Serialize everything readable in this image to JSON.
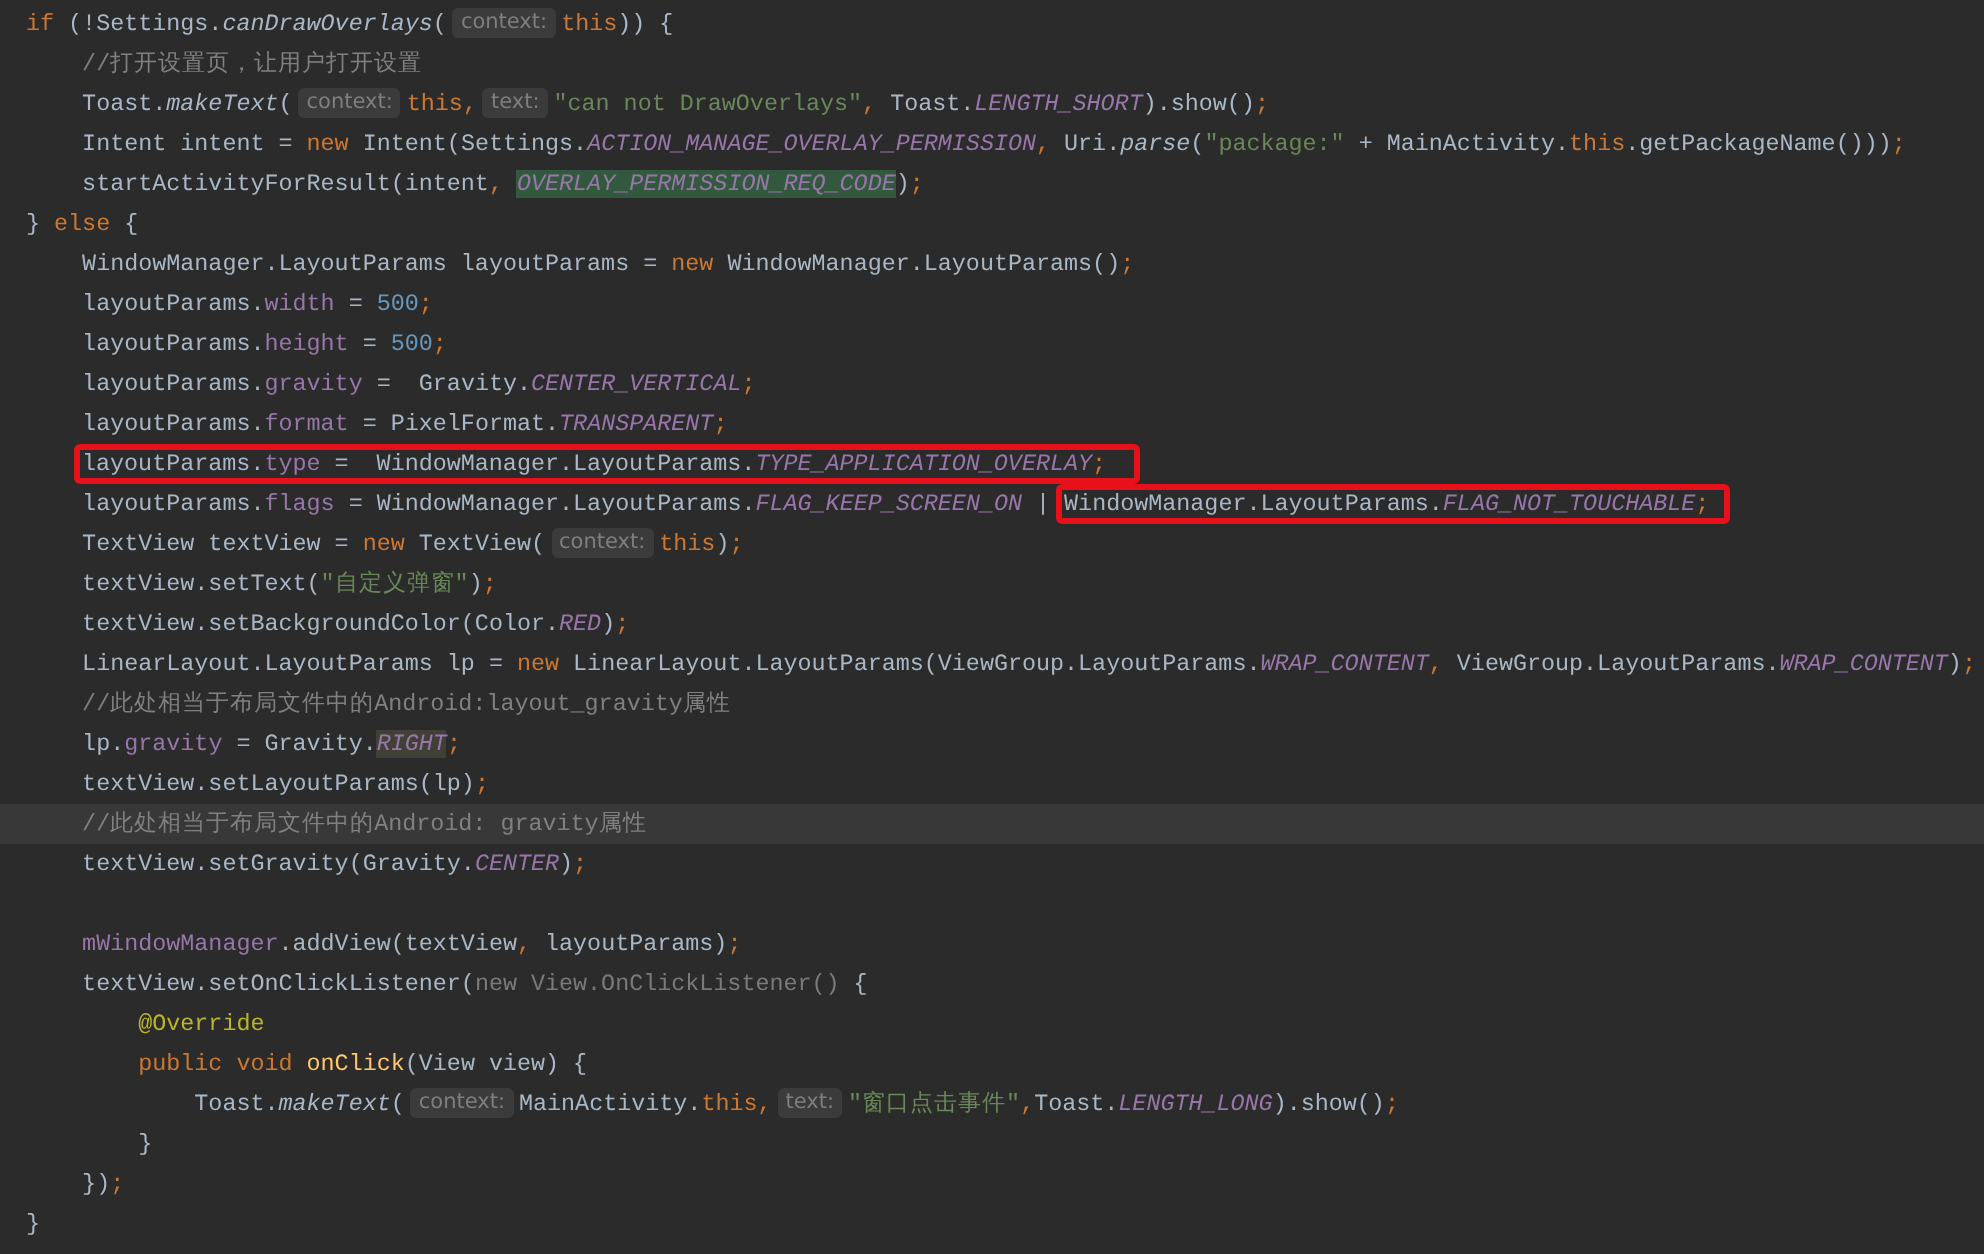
{
  "editor": {
    "lines": [
      {
        "current": false,
        "tokens": [
          {
            "kind": "keyword",
            "text": "if"
          },
          {
            "kind": "plain",
            "text": " (!Settings."
          },
          {
            "kind": "static_call",
            "text": "canDrawOverlays"
          },
          {
            "kind": "plain",
            "text": "("
          },
          {
            "kind": "hint",
            "text": "context:"
          },
          {
            "kind": "keyword",
            "text": "this"
          },
          {
            "kind": "plain",
            "text": ")) {"
          }
        ]
      },
      {
        "current": false,
        "tokens": [
          {
            "kind": "comment",
            "text": "    //打开设置页，让用户打开设置"
          }
        ]
      },
      {
        "current": false,
        "tokens": [
          {
            "kind": "plain",
            "text": "    Toast."
          },
          {
            "kind": "static_call",
            "text": "makeText"
          },
          {
            "kind": "plain",
            "text": "("
          },
          {
            "kind": "hint",
            "text": "context:"
          },
          {
            "kind": "keyword",
            "text": "this,"
          },
          {
            "kind": "hint",
            "text": "text:"
          },
          {
            "kind": "string",
            "text": "\"can not DrawOverlays\""
          },
          {
            "kind": "punct",
            "text": ", "
          },
          {
            "kind": "plain",
            "text": "Toast."
          },
          {
            "kind": "static",
            "text": "LENGTH_SHORT"
          },
          {
            "kind": "plain",
            "text": ").show()"
          },
          {
            "kind": "punct",
            "text": ";"
          }
        ]
      },
      {
        "current": false,
        "tokens": [
          {
            "kind": "plain",
            "text": "    Intent intent = "
          },
          {
            "kind": "keyword",
            "text": "new "
          },
          {
            "kind": "plain",
            "text": "Intent(Settings."
          },
          {
            "kind": "static",
            "text": "ACTION_MANAGE_OVERLAY_PERMISSION"
          },
          {
            "kind": "punct",
            "text": ", "
          },
          {
            "kind": "plain",
            "text": "Uri."
          },
          {
            "kind": "static_call",
            "text": "parse"
          },
          {
            "kind": "plain",
            "text": "("
          },
          {
            "kind": "string",
            "text": "\"package:\""
          },
          {
            "kind": "plain",
            "text": " + MainActivity."
          },
          {
            "kind": "keyword",
            "text": "this"
          },
          {
            "kind": "plain",
            "text": ".getPackageName()))"
          },
          {
            "kind": "punct",
            "text": ";"
          }
        ]
      },
      {
        "current": false,
        "tokens": [
          {
            "kind": "plain",
            "text": "    startActivityForResult(intent"
          },
          {
            "kind": "punct",
            "text": ", "
          },
          {
            "kind": "static",
            "text": "OVERLAY_PERMISSION_REQ_CODE",
            "color": "#32593d"
          },
          {
            "kind": "plain",
            "text": ")"
          },
          {
            "kind": "punct",
            "text": ";"
          }
        ]
      },
      {
        "current": false,
        "tokens": [
          {
            "kind": "plain",
            "text": "} "
          },
          {
            "kind": "keyword",
            "text": "else"
          },
          {
            "kind": "plain",
            "text": " {"
          }
        ]
      },
      {
        "current": false,
        "tokens": [
          {
            "kind": "plain",
            "text": "    WindowManager.LayoutParams layoutParams = "
          },
          {
            "kind": "keyword",
            "text": "new "
          },
          {
            "kind": "plain",
            "text": "WindowManager.LayoutParams()"
          },
          {
            "kind": "punct",
            "text": ";"
          }
        ]
      },
      {
        "current": false,
        "tokens": [
          {
            "kind": "plain",
            "text": "    layoutParams."
          },
          {
            "kind": "field",
            "text": "width"
          },
          {
            "kind": "plain",
            "text": " = "
          },
          {
            "kind": "number",
            "text": "500"
          },
          {
            "kind": "punct",
            "text": ";"
          }
        ]
      },
      {
        "current": false,
        "tokens": [
          {
            "kind": "plain",
            "text": "    layoutParams."
          },
          {
            "kind": "field",
            "text": "height"
          },
          {
            "kind": "plain",
            "text": " = "
          },
          {
            "kind": "number",
            "text": "500"
          },
          {
            "kind": "punct",
            "text": ";"
          }
        ]
      },
      {
        "current": false,
        "tokens": [
          {
            "kind": "plain",
            "text": "    layoutParams."
          },
          {
            "kind": "field",
            "text": "gravity"
          },
          {
            "kind": "plain",
            "text": " =  Gravity."
          },
          {
            "kind": "static",
            "text": "CENTER_VERTICAL"
          },
          {
            "kind": "punct",
            "text": ";"
          }
        ]
      },
      {
        "current": false,
        "tokens": [
          {
            "kind": "plain",
            "text": "    layoutParams."
          },
          {
            "kind": "field",
            "text": "format"
          },
          {
            "kind": "plain",
            "text": " = PixelFormat."
          },
          {
            "kind": "static",
            "text": "TRANSPARENT"
          },
          {
            "kind": "punct",
            "text": ";"
          }
        ]
      },
      {
        "current": false,
        "tokens": [
          {
            "kind": "box",
            "tokens": [
              {
                "kind": "plain",
                "text": "layoutParams."
              },
              {
                "kind": "field",
                "text": "type"
              },
              {
                "kind": "plain",
                "text": " =  WindowManager.LayoutParams."
              },
              {
                "kind": "static",
                "text": "TYPE_APPLICATION_OVERLAY"
              },
              {
                "kind": "punct",
                "text": ";"
              }
            ]
          }
        ]
      },
      {
        "current": false,
        "tokens": [
          {
            "kind": "plain",
            "text": "    layoutParams."
          },
          {
            "kind": "field",
            "text": "flags"
          },
          {
            "kind": "plain",
            "text": " = WindowManager.LayoutParams."
          },
          {
            "kind": "static",
            "text": "FLAG_KEEP_SCREEN_ON"
          },
          {
            "kind": "plain",
            "text": " | "
          },
          {
            "kind": "box",
            "tokens": [
              {
                "kind": "plain",
                "text": "WindowManager.LayoutParams."
              },
              {
                "kind": "static",
                "text": "FLAG_NOT_TOUCHABLE"
              }
            ]
          },
          {
            "kind": "punct",
            "text": ";"
          }
        ]
      },
      {
        "current": false,
        "tokens": [
          {
            "kind": "plain",
            "text": "    TextView textView = "
          },
          {
            "kind": "keyword",
            "text": "new "
          },
          {
            "kind": "plain",
            "text": "TextView("
          },
          {
            "kind": "hint",
            "text": "context:"
          },
          {
            "kind": "keyword",
            "text": "this"
          },
          {
            "kind": "plain",
            "text": ")"
          },
          {
            "kind": "punct",
            "text": ";"
          }
        ]
      },
      {
        "current": false,
        "tokens": [
          {
            "kind": "plain",
            "text": "    textView.setText("
          },
          {
            "kind": "string",
            "text": "\"自定义弹窗\""
          },
          {
            "kind": "plain",
            "text": ")"
          },
          {
            "kind": "punct",
            "text": ";"
          }
        ]
      },
      {
        "current": false,
        "tokens": [
          {
            "kind": "plain",
            "text": "    textView.setBackgroundColor(Color."
          },
          {
            "kind": "static",
            "text": "RED"
          },
          {
            "kind": "plain",
            "text": ")"
          },
          {
            "kind": "punct",
            "text": ";"
          }
        ]
      },
      {
        "current": false,
        "tokens": [
          {
            "kind": "plain",
            "text": "    LinearLayout.LayoutParams lp = "
          },
          {
            "kind": "keyword",
            "text": "new "
          },
          {
            "kind": "plain",
            "text": "LinearLayout.LayoutParams(ViewGroup.LayoutParams."
          },
          {
            "kind": "static",
            "text": "WRAP_CONTENT"
          },
          {
            "kind": "punct",
            "text": ", "
          },
          {
            "kind": "plain",
            "text": "ViewGroup.LayoutParams."
          },
          {
            "kind": "static",
            "text": "WRAP_CONTENT"
          },
          {
            "kind": "plain",
            "text": ")"
          },
          {
            "kind": "punct",
            "text": ";"
          }
        ]
      },
      {
        "current": false,
        "tokens": [
          {
            "kind": "comment",
            "text": "    //此处相当于布局文件中的Android:layout_gravity属性"
          }
        ]
      },
      {
        "current": false,
        "tokens": [
          {
            "kind": "plain",
            "text": "    lp."
          },
          {
            "kind": "field",
            "text": "gravity"
          },
          {
            "kind": "plain",
            "text": " = Gravity."
          },
          {
            "kind": "static",
            "text": "RIGHT",
            "color": "#404036"
          },
          {
            "kind": "punct",
            "text": ";"
          }
        ]
      },
      {
        "current": false,
        "tokens": [
          {
            "kind": "plain",
            "text": "    textView.setLayoutParams(lp)"
          },
          {
            "kind": "punct",
            "text": ";"
          }
        ]
      },
      {
        "current": true,
        "tokens": [
          {
            "kind": "comment",
            "text": "    //此处相当于布局文件中的Android: gravity属性"
          }
        ]
      },
      {
        "current": false,
        "tokens": [
          {
            "kind": "plain",
            "text": "    textView.setGravity(Gravity."
          },
          {
            "kind": "static",
            "text": "CENTER"
          },
          {
            "kind": "plain",
            "text": ")"
          },
          {
            "kind": "punct",
            "text": ";"
          }
        ]
      },
      {
        "current": false
      },
      {
        "current": false,
        "tokens": [
          {
            "kind": "field",
            "text": "    mWindowManager"
          },
          {
            "kind": "plain",
            "text": ".addView(textView"
          },
          {
            "kind": "punct",
            "text": ", "
          },
          {
            "kind": "plain",
            "text": "layoutParams)"
          },
          {
            "kind": "punct",
            "text": ";"
          }
        ]
      },
      {
        "current": false,
        "tokens": [
          {
            "kind": "plain",
            "text": "    textView.setOnClickListener("
          },
          {
            "kind": "muted",
            "text": "new View.OnClickListener()"
          },
          {
            "kind": "plain",
            "text": " {"
          }
        ]
      },
      {
        "current": false,
        "tokens": [
          {
            "kind": "annotation",
            "text": "        @Override"
          }
        ]
      },
      {
        "current": false,
        "tokens": [
          {
            "kind": "keyword",
            "text": "        public void "
          },
          {
            "kind": "declaration",
            "text": "onClick"
          },
          {
            "kind": "plain",
            "text": "(View view) {"
          }
        ]
      },
      {
        "current": false,
        "tokens": [
          {
            "kind": "plain",
            "text": "            Toast."
          },
          {
            "kind": "static_call",
            "text": "makeText"
          },
          {
            "kind": "plain",
            "text": "("
          },
          {
            "kind": "hint",
            "text": "context:"
          },
          {
            "kind": "plain",
            "text": "MainActivity."
          },
          {
            "kind": "keyword",
            "text": "this,"
          },
          {
            "kind": "hint",
            "text": "text:"
          },
          {
            "kind": "string",
            "text": "\"窗口点击事件\""
          },
          {
            "kind": "punct",
            "text": ","
          },
          {
            "kind": "plain",
            "text": "Toast."
          },
          {
            "kind": "static",
            "text": "LENGTH_LONG"
          },
          {
            "kind": "plain",
            "text": ").show()"
          },
          {
            "kind": "punct",
            "text": ";"
          }
        ]
      },
      {
        "current": false,
        "tokens": [
          {
            "kind": "plain",
            "text": "        }"
          }
        ]
      },
      {
        "current": false,
        "tokens": [
          {
            "kind": "plain",
            "text": "    })"
          },
          {
            "kind": "punct",
            "text": ";"
          }
        ]
      },
      {
        "current": false,
        "tokens": [
          {
            "kind": "plain",
            "text": "}"
          }
        ]
      }
    ]
  }
}
